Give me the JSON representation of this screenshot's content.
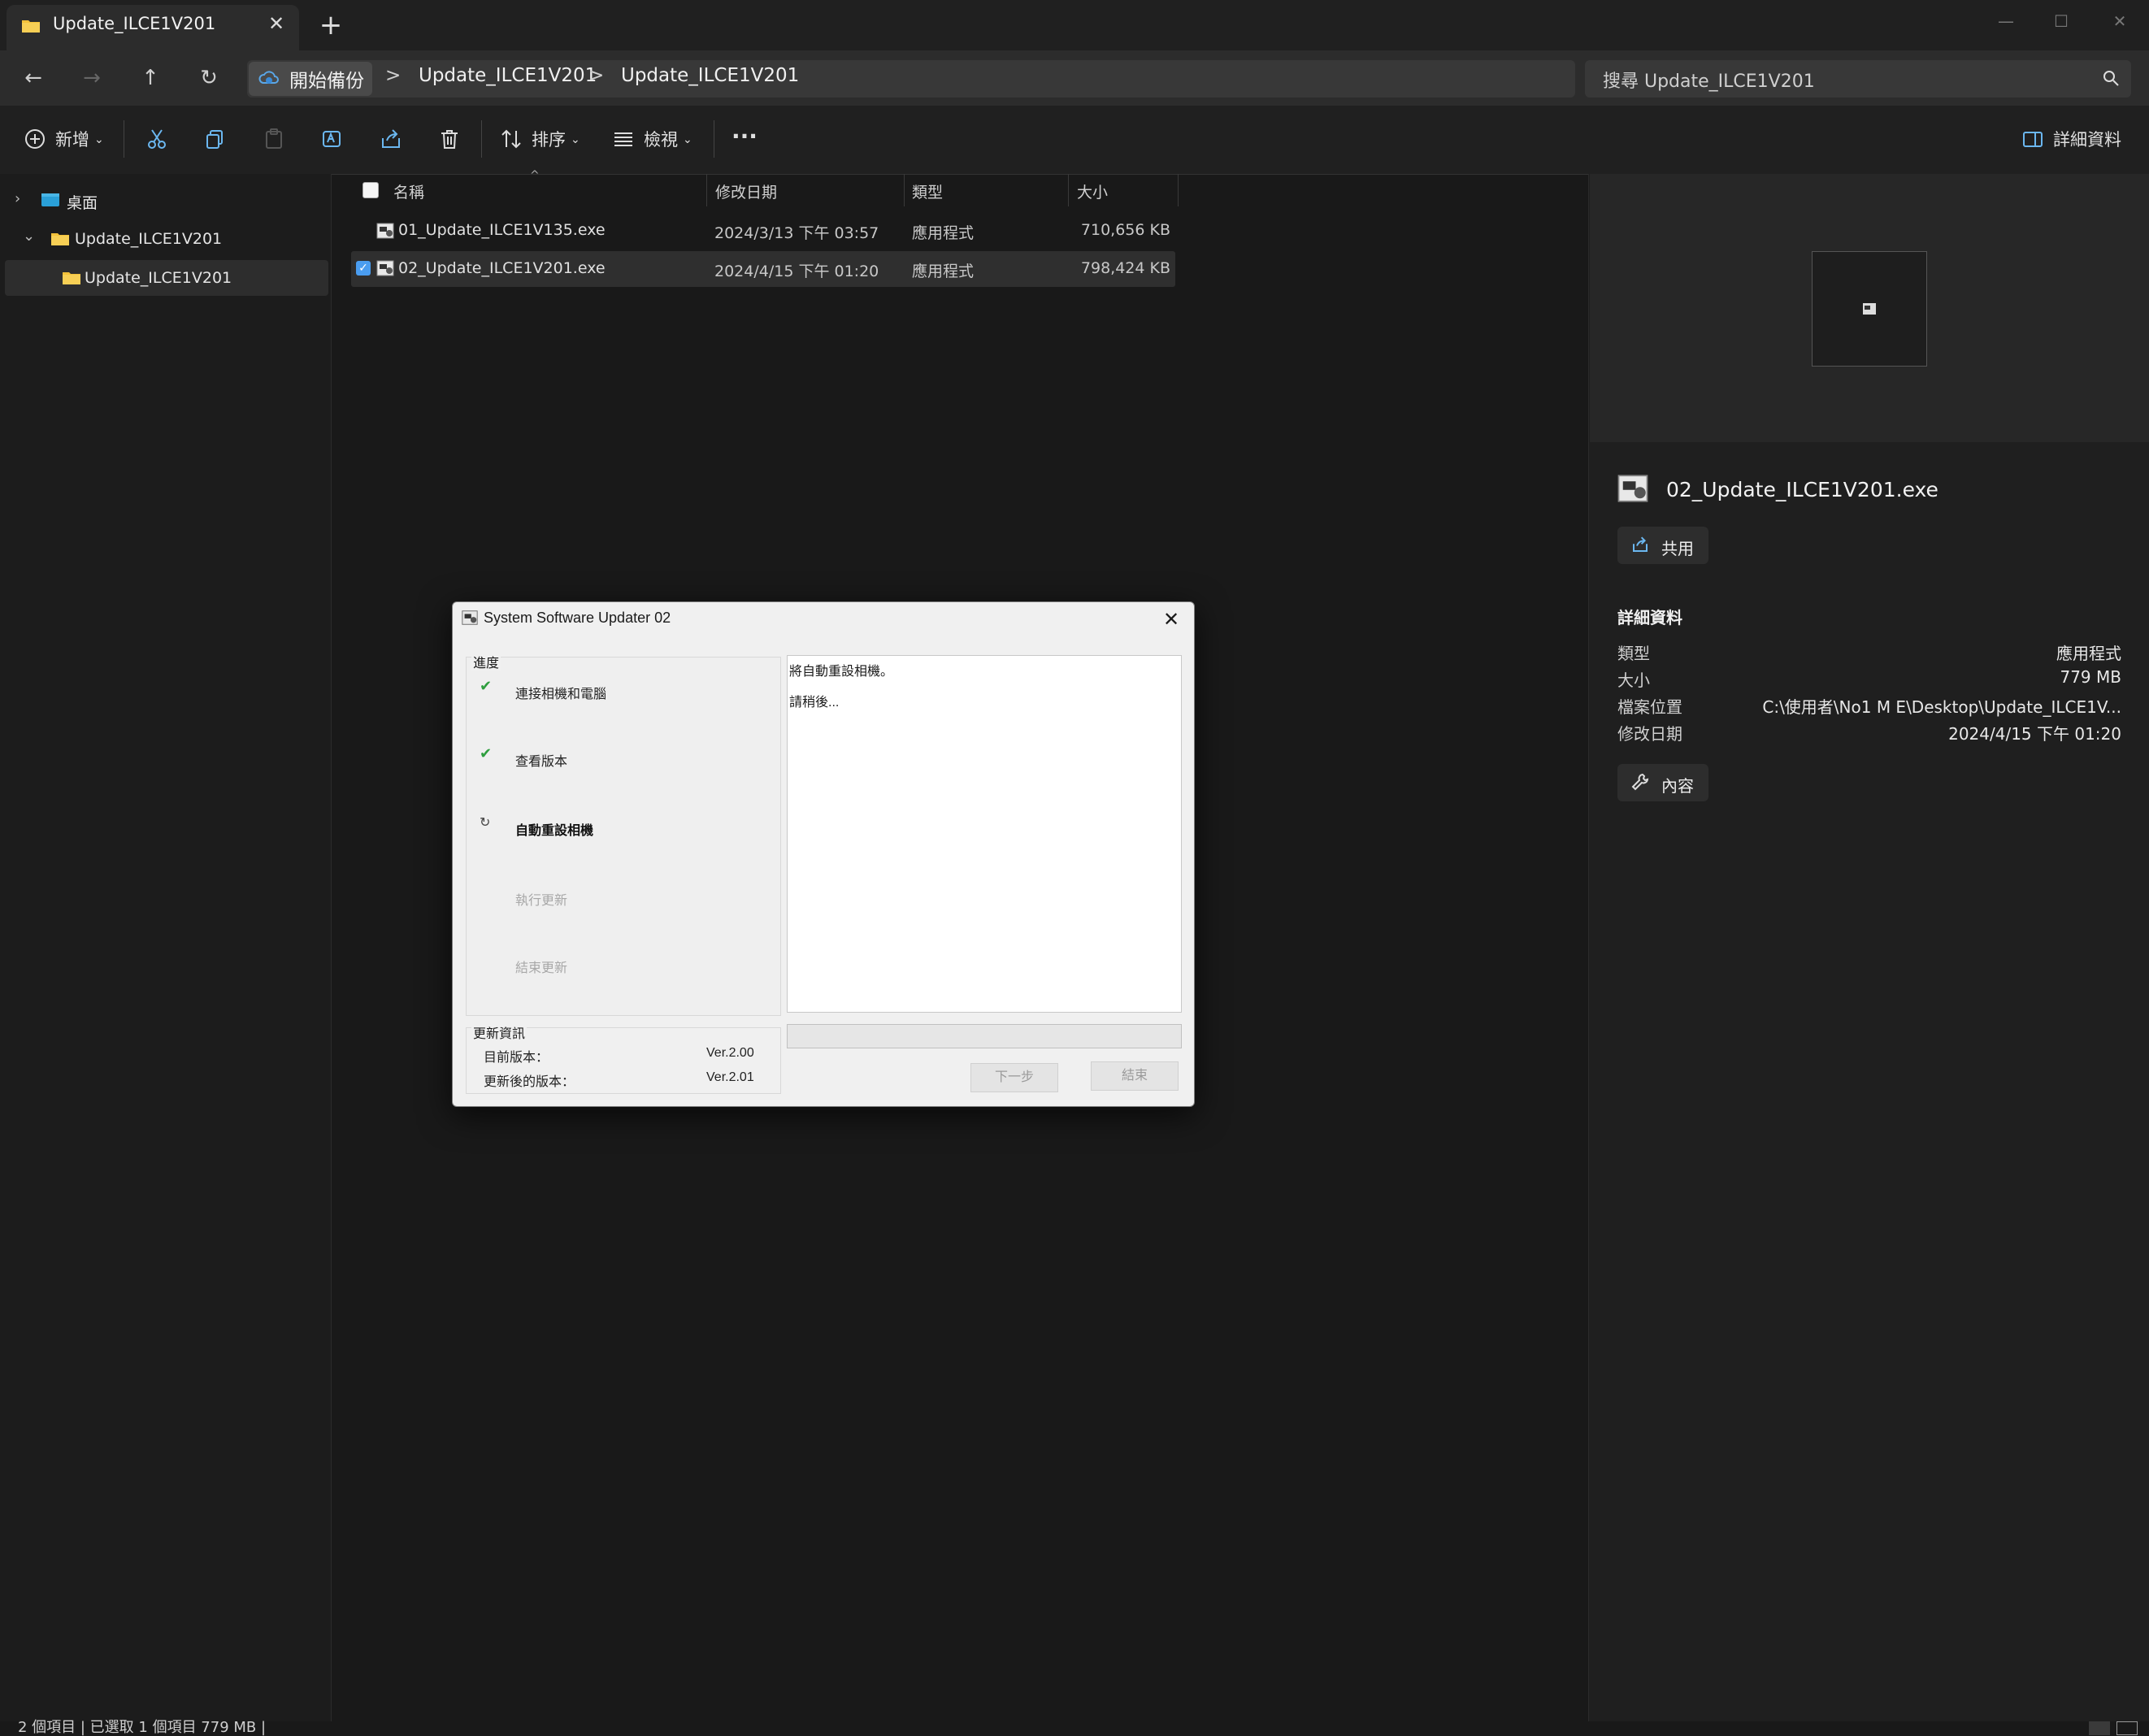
{
  "window": {
    "tab_title": "Update_ILCE1V201",
    "close_tab": "✕",
    "new_tab": "+"
  },
  "nav": {
    "breadcrumb": [
      "開始備份",
      "Update_ILCE1V201",
      "Update_ILCE1V201"
    ],
    "breadcrumb_sep": ">",
    "search_placeholder": "搜尋 Update_ILCE1V201"
  },
  "commands": {
    "new": "新增",
    "sort": "排序",
    "view": "檢視",
    "more": "···",
    "details": "詳細資料"
  },
  "tree": [
    {
      "label": "桌面",
      "icon": "desktop-icon",
      "expanded": false
    },
    {
      "label": "Update_ILCE1V201",
      "icon": "folder-icon",
      "expanded": true
    },
    {
      "label": "Update_ILCE1V201",
      "icon": "folder-icon",
      "selected": true
    }
  ],
  "columns": {
    "name": "名稱",
    "date": "修改日期",
    "type": "類型",
    "size": "大小"
  },
  "files": [
    {
      "name": "01_Update_ILCE1V135.exe",
      "date": "2024/3/13 下午 03:57",
      "type": "應用程式",
      "size": "710,656 KB",
      "selected": false
    },
    {
      "name": "02_Update_ILCE1V201.exe",
      "date": "2024/4/15 下午 01:20",
      "type": "應用程式",
      "size": "798,424 KB",
      "selected": true
    }
  ],
  "details_pane": {
    "file_name": "02_Update_ILCE1V201.exe",
    "share_label": "共用",
    "section_title": "詳細資料",
    "props": [
      {
        "label": "類型",
        "value": "應用程式"
      },
      {
        "label": "大小",
        "value": "779 MB"
      },
      {
        "label": "檔案位置",
        "value": "C:\\使用者\\No1 M E\\Desktop\\Update_ILCE1V..."
      },
      {
        "label": "修改日期",
        "value": "2024/4/15 下午 01:20"
      }
    ],
    "properties_label": "內容"
  },
  "status": {
    "text": "2 個項目  |  已選取 1 個項目 779 MB  |"
  },
  "dialog": {
    "title": "System Software Updater 02",
    "progress_label": "進度",
    "steps": [
      {
        "label": "連接相機和電腦",
        "state": "done"
      },
      {
        "label": "查看版本",
        "state": "done"
      },
      {
        "label": "自動重設相機",
        "state": "active"
      },
      {
        "label": "執行更新",
        "state": "pending"
      },
      {
        "label": "結束更新",
        "state": "pending"
      }
    ],
    "log_lines": [
      "將自動重設相機。",
      "請稍後..."
    ],
    "info_label": "更新資訊",
    "current_version_label": "目前版本：",
    "current_version": "Ver.2.00",
    "new_version_label": "更新後的版本：",
    "new_version": "Ver.2.01",
    "progress": 0,
    "next_button": "下一步",
    "finish_button": "結束"
  }
}
